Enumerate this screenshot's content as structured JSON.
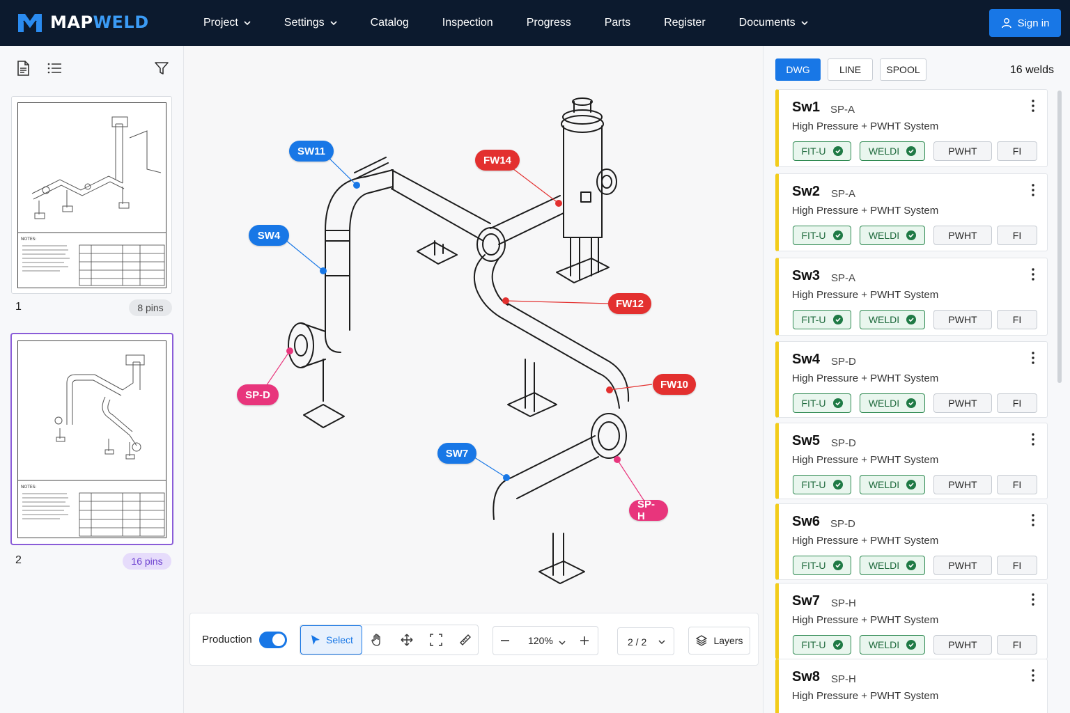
{
  "brand": {
    "part_a": "MAP",
    "part_b": "WELD"
  },
  "nav": [
    {
      "label": "Project",
      "dropdown": true
    },
    {
      "label": "Settings",
      "dropdown": true
    },
    {
      "label": "Catalog",
      "dropdown": false
    },
    {
      "label": "Inspection",
      "dropdown": false
    },
    {
      "label": "Progress",
      "dropdown": false
    },
    {
      "label": "Parts",
      "dropdown": false
    },
    {
      "label": "Register",
      "dropdown": false
    },
    {
      "label": "Documents",
      "dropdown": true
    }
  ],
  "signin_label": "Sign in",
  "pages": [
    {
      "number": "1",
      "pins": "8 pins",
      "selected": false
    },
    {
      "number": "2",
      "pins": "16 pins",
      "selected": true
    }
  ],
  "pins": [
    {
      "label": "SW11",
      "color": "blue"
    },
    {
      "label": "FW14",
      "color": "red"
    },
    {
      "label": "SW4",
      "color": "blue"
    },
    {
      "label": "FW12",
      "color": "red"
    },
    {
      "label": "SP-D",
      "color": "pink"
    },
    {
      "label": "FW10",
      "color": "red"
    },
    {
      "label": "SW7",
      "color": "blue"
    },
    {
      "label": "SP-H",
      "color": "pink"
    }
  ],
  "toolbar": {
    "production_label": "Production",
    "production_on": true,
    "select_label": "Select",
    "zoom": "120%",
    "page": "2 / 2",
    "layers_label": "Layers"
  },
  "right": {
    "tabs": [
      "DWG",
      "LINE",
      "SPOOL"
    ],
    "active_tab": "DWG",
    "count": "16 welds",
    "welds": [
      {
        "id": "Sw1",
        "spool": "SP-A",
        "desc": "High Pressure + PWHT System",
        "steps": [
          {
            "label": "FIT-U",
            "done": true
          },
          {
            "label": "WELDI",
            "done": true
          },
          {
            "label": "PWHT",
            "done": false
          },
          {
            "label": "FI",
            "done": false
          }
        ]
      },
      {
        "id": "Sw2",
        "spool": "SP-A",
        "desc": "High Pressure + PWHT System",
        "steps": [
          {
            "label": "FIT-U",
            "done": true
          },
          {
            "label": "WELDI",
            "done": true
          },
          {
            "label": "PWHT",
            "done": false
          },
          {
            "label": "FI",
            "done": false
          }
        ]
      },
      {
        "id": "Sw3",
        "spool": "SP-A",
        "desc": "High Pressure + PWHT System",
        "steps": [
          {
            "label": "FIT-U",
            "done": true
          },
          {
            "label": "WELDI",
            "done": true
          },
          {
            "label": "PWHT",
            "done": false
          },
          {
            "label": "FI",
            "done": false
          }
        ]
      },
      {
        "id": "Sw4",
        "spool": "SP-D",
        "desc": "High Pressure + PWHT System",
        "steps": [
          {
            "label": "FIT-U",
            "done": true
          },
          {
            "label": "WELDI",
            "done": true
          },
          {
            "label": "PWHT",
            "done": false
          },
          {
            "label": "FI",
            "done": false
          }
        ]
      },
      {
        "id": "Sw5",
        "spool": "SP-D",
        "desc": "High Pressure + PWHT System",
        "steps": [
          {
            "label": "FIT-U",
            "done": true
          },
          {
            "label": "WELDI",
            "done": true
          },
          {
            "label": "PWHT",
            "done": false
          },
          {
            "label": "FI",
            "done": false
          }
        ]
      },
      {
        "id": "Sw6",
        "spool": "SP-D",
        "desc": "High Pressure + PWHT System",
        "steps": [
          {
            "label": "FIT-U",
            "done": true
          },
          {
            "label": "WELDI",
            "done": true
          },
          {
            "label": "PWHT",
            "done": false
          },
          {
            "label": "FI",
            "done": false
          }
        ]
      },
      {
        "id": "Sw7",
        "spool": "SP-H",
        "desc": "High Pressure + PWHT System",
        "steps": [
          {
            "label": "FIT-U",
            "done": true
          },
          {
            "label": "WELDI",
            "done": true
          },
          {
            "label": "PWHT",
            "done": false
          },
          {
            "label": "FI",
            "done": false
          }
        ]
      },
      {
        "id": "Sw8",
        "spool": "SP-H",
        "desc": "High Pressure + PWHT System",
        "steps": []
      }
    ]
  },
  "colors": {
    "accent": "#1877e6",
    "nav_bg": "#0c1a2e",
    "pin_blue": "#1877e6",
    "pin_red": "#e3302f",
    "pin_pink": "#e8357c",
    "status_stripe": "#f2cc1a",
    "done_green": "#1f7a45"
  }
}
